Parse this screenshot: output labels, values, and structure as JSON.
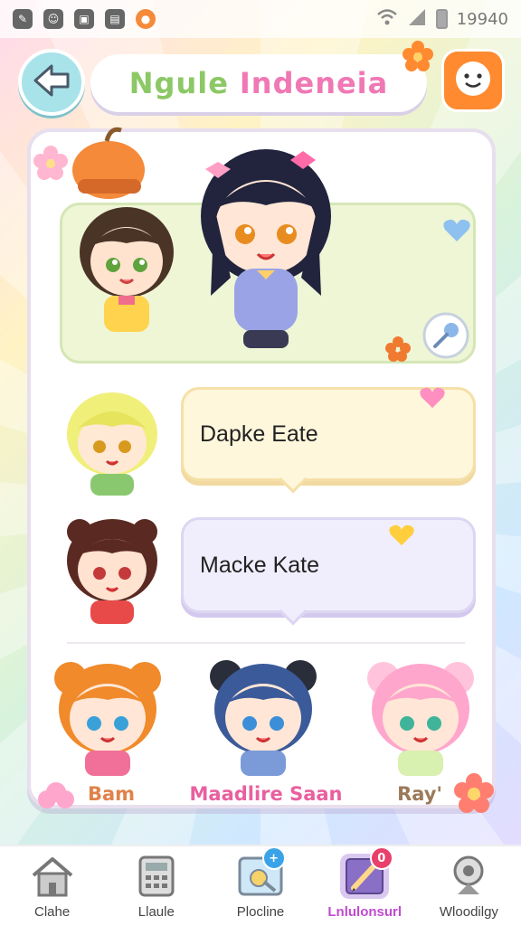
{
  "status_bar": {
    "time": "19940",
    "left_icons": [
      "tool-icon",
      "chat-icon",
      "app-icon",
      "image-icon",
      "game-icon"
    ]
  },
  "header": {
    "title_part1": "Ngule",
    "title_part2": "Indeneia",
    "back_icon": "back-arrow-icon",
    "profile_icon": "smiley-face-icon"
  },
  "featured": {
    "characters": [
      "brown-hair-chibi",
      "navy-hair-chibi"
    ]
  },
  "messages": [
    {
      "text": "Dapke Eate",
      "style": "yellow"
    },
    {
      "text": "Macke Kate",
      "style": "lilac"
    }
  ],
  "members": [
    {
      "name": "Bam",
      "color": "#e0824a"
    },
    {
      "name": "Maadlire Saan",
      "color": "#e8609f"
    },
    {
      "name": "Ray'",
      "color": "#9b7a5a"
    }
  ],
  "bottom_nav": [
    {
      "label": "Clahe",
      "icon": "home-icon",
      "active": false,
      "badge": ""
    },
    {
      "label": "Llaule",
      "icon": "calculator-icon",
      "active": false,
      "badge": ""
    },
    {
      "label": "Plocline",
      "icon": "photo-editor-icon",
      "active": false,
      "badge": "+"
    },
    {
      "label": "Lnlulonsurl",
      "icon": "pencil-notebook-icon",
      "active": true,
      "badge": "0"
    },
    {
      "label": "Wloodilgy",
      "icon": "webcam-icon",
      "active": false,
      "badge": ""
    }
  ],
  "colors": {
    "accent_orange": "#ff8a30",
    "title_green": "#8cc865",
    "title_pink": "#f078b4",
    "active_nav": "#c04bd0"
  }
}
